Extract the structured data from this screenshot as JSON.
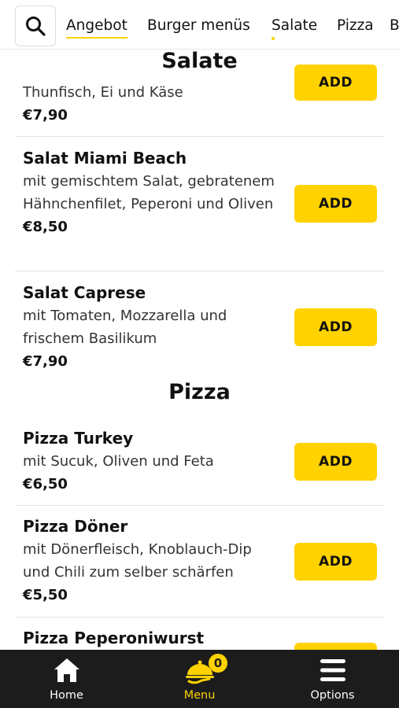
{
  "categories": [
    "Angebot",
    "Burger menüs",
    "Salate",
    "Pizza",
    "B"
  ],
  "sections": {
    "salate": {
      "title": "Salate"
    },
    "pizza": {
      "title": "Pizza"
    }
  },
  "items": [
    {
      "name": "",
      "description": "Thunfisch, Ei und Käse",
      "price": "€7,90",
      "add_label": "ADD"
    },
    {
      "name": "Salat Miami Beach",
      "description": "mit gemischtem Salat, gebratenem Hähnchenfilet, Peperoni und Oliven",
      "price": "€8,50",
      "add_label": "ADD"
    },
    {
      "name": "Salat Caprese",
      "description": "mit Tomaten, Mozzarella und frischem Basilikum",
      "price": "€7,90",
      "add_label": "ADD"
    },
    {
      "name": "Pizza Turkey",
      "description": "mit Sucuk, Oliven und Feta",
      "price": "€6,50",
      "add_label": "ADD"
    },
    {
      "name": "Pizza Döner",
      "description": "mit Dönerfleisch, Knoblauch-Dip und Chili zum selber schärfen",
      "price": "€5,50",
      "add_label": "ADD"
    },
    {
      "name": "Pizza Peperoniwurst",
      "description": "",
      "price": "",
      "add_label": ""
    }
  ],
  "bottom_nav": {
    "home": {
      "label": "Home",
      "icon": "home-icon"
    },
    "menu": {
      "label": "Menu",
      "icon": "cloche-icon",
      "badge": "0"
    },
    "options": {
      "label": "Options",
      "icon": "hamburger-menu-icon"
    }
  },
  "colors": {
    "accent": "#ffd200",
    "nav_bg": "#1c1c1c"
  }
}
